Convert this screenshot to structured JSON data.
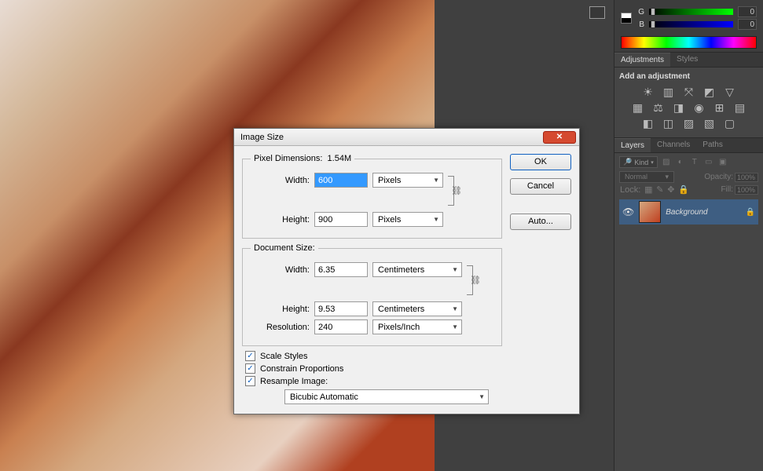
{
  "color": {
    "g_label": "G",
    "g_value": "0",
    "b_label": "B",
    "b_value": "0"
  },
  "adjustments": {
    "tabs": [
      "Adjustments",
      "Styles"
    ],
    "heading": "Add an adjustment"
  },
  "layers": {
    "tabs": [
      "Layers",
      "Channels",
      "Paths"
    ],
    "kind_label": "Kind",
    "blend_mode": "Normal",
    "opacity_label": "Opacity:",
    "opacity_value": "100%",
    "lock_label": "Lock:",
    "fill_label": "Fill:",
    "fill_value": "100%",
    "layer_name": "Background"
  },
  "dialog": {
    "title": "Image Size",
    "buttons": {
      "ok": "OK",
      "cancel": "Cancel",
      "auto": "Auto..."
    },
    "pixel_dimensions": {
      "legend": "Pixel Dimensions:",
      "size": "1.54M",
      "width_label": "Width:",
      "width_value": "600",
      "width_unit": "Pixels",
      "height_label": "Height:",
      "height_value": "900",
      "height_unit": "Pixels"
    },
    "document_size": {
      "legend": "Document Size:",
      "width_label": "Width:",
      "width_value": "6.35",
      "width_unit": "Centimeters",
      "height_label": "Height:",
      "height_value": "9.53",
      "height_unit": "Centimeters",
      "resolution_label": "Resolution:",
      "resolution_value": "240",
      "resolution_unit": "Pixels/Inch"
    },
    "checkboxes": {
      "scale_styles": "Scale Styles",
      "constrain": "Constrain Proportions",
      "resample": "Resample Image:",
      "resample_method": "Bicubic Automatic"
    }
  }
}
